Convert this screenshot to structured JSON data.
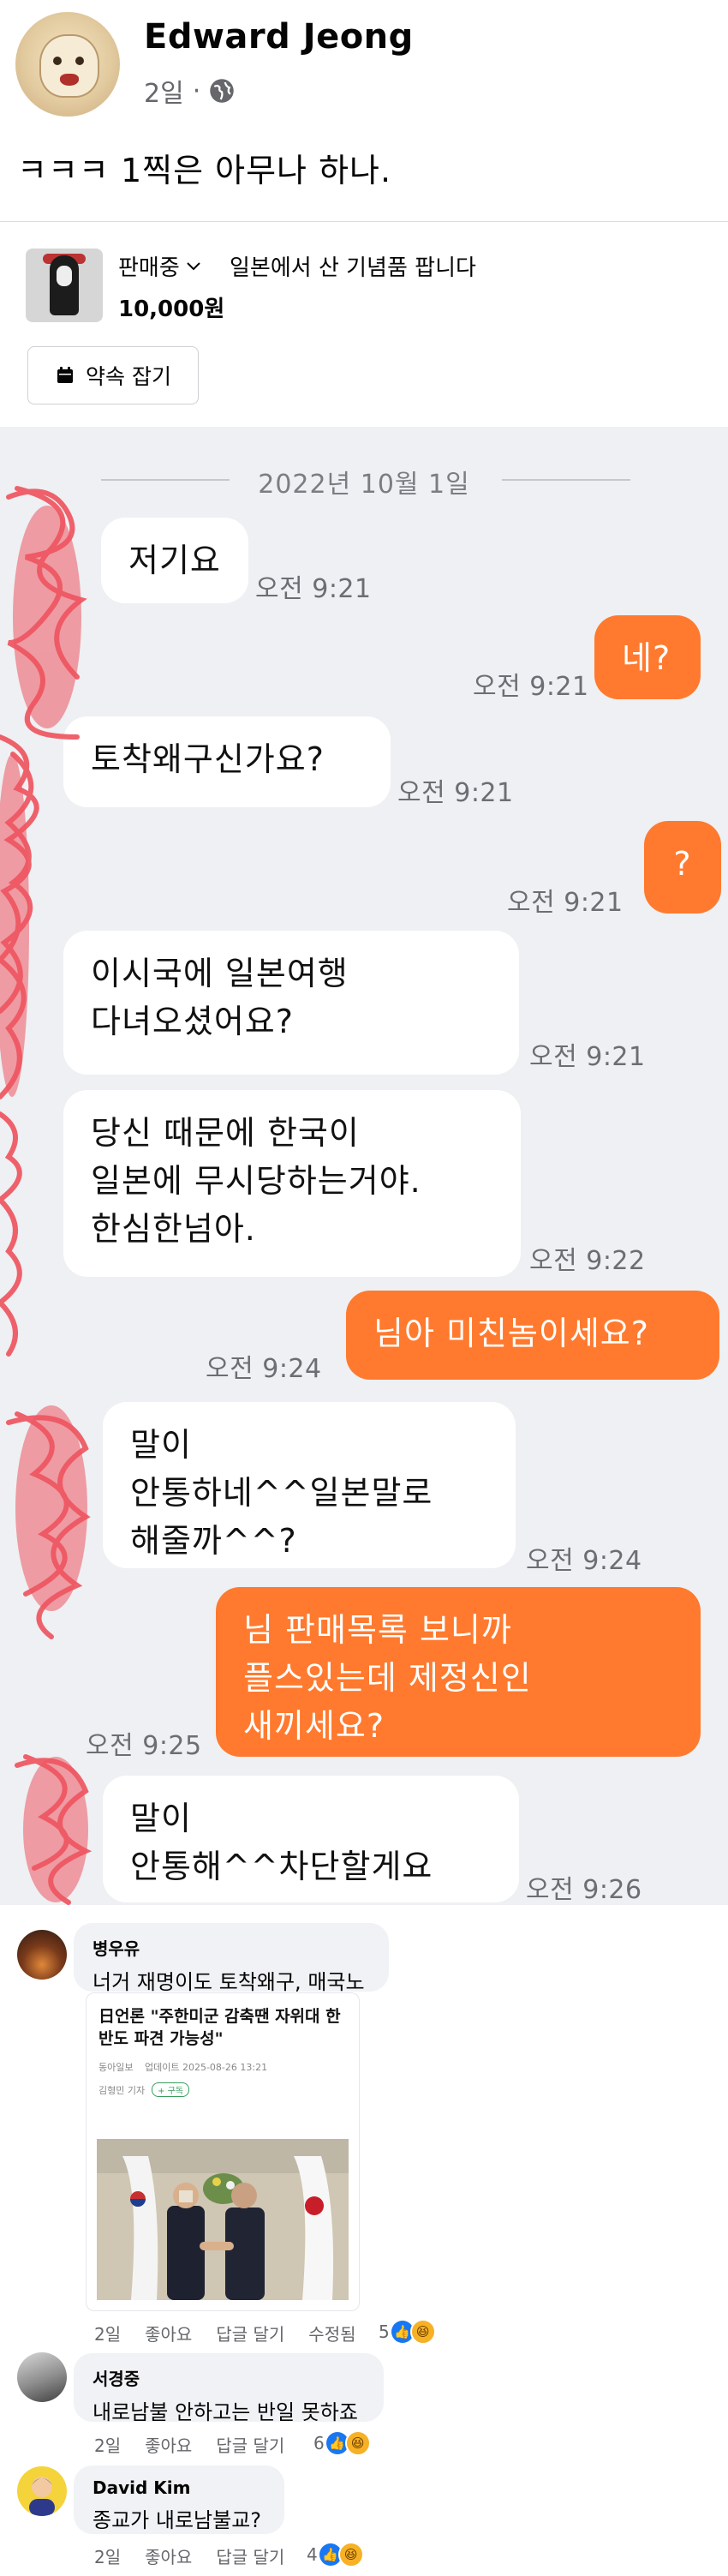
{
  "post": {
    "author": "Edward Jeong",
    "time": "2일",
    "separator": "·",
    "text": "ㅋㅋㅋ 1찍은 아무나 하나."
  },
  "listing": {
    "status": "판매중",
    "title": "일본에서 산 기념품 팝니다",
    "price": "10,000원",
    "appointment_label": "약속 잡기"
  },
  "chat": {
    "date": "2022년 10월 1일",
    "messages": [
      {
        "dir": "in",
        "text": "저기요",
        "time": "오전 9:21"
      },
      {
        "dir": "out",
        "text": "네?",
        "time": "오전 9:21"
      },
      {
        "dir": "in",
        "text": "토착왜구신가요?",
        "time": "오전 9:21"
      },
      {
        "dir": "out",
        "text": "?",
        "time": "오전 9:21"
      },
      {
        "dir": "in",
        "text": "이시국에 일본여행\n다녀오셨어요?",
        "time": "오전 9:21"
      },
      {
        "dir": "in",
        "text": "당신 때문에 한국이\n일본에 무시당하는거야.\n한심한넘아.",
        "time": "오전 9:22"
      },
      {
        "dir": "out",
        "text": "님아 미친놈이세요?",
        "time": "오전 9:24"
      },
      {
        "dir": "in",
        "text": "말이\n안통하네^^일본말로\n해줄까^^?",
        "time": "오전 9:24"
      },
      {
        "dir": "out",
        "text": "님 판매목록 보니까\n플스있는데 제정신인\n새끼세요?",
        "time": "오전 9:25"
      },
      {
        "dir": "in",
        "text": "말이\n안통해^^차단할게요",
        "time": "오전 9:26"
      }
    ]
  },
  "comments": [
    {
      "name": "병우유",
      "text": "너거 재명이도 토착왜구, 매국노",
      "time": "2일",
      "like": "좋아요",
      "reply": "답글 달기",
      "edited": "수정됨",
      "reactions": "5",
      "attachment": {
        "headline": "日언론 \"주한미군 감축땐 자위대 한반도 파견 가능성\"",
        "source": "동아일보",
        "updated": "업데이트 2025-08-26 13:21",
        "reporter": "김형민 기자",
        "subscribe": "+ 구독"
      }
    },
    {
      "name": "서경중",
      "text": "내로남불 안하고는 반일 못하죠",
      "time": "2일",
      "like": "좋아요",
      "reply": "답글 달기",
      "reactions": "6"
    },
    {
      "name": "David Kim",
      "text": "종교가 내로남불교?",
      "time": "2일",
      "like": "좋아요",
      "reply": "답글 달기",
      "reactions": "4"
    }
  ],
  "icons": {
    "audience": "globe-icon",
    "status_dropdown": "chevron-down-icon",
    "appointment": "calendar-icon",
    "like": "like-icon",
    "haha": "haha-icon"
  },
  "colors": {
    "outgoing_bubble": "#ff7a2e",
    "incoming_bubble": "#ffffff",
    "chat_background": "#eef0f3",
    "like_blue": "#1877f2",
    "haha_yellow": "#f7b125"
  }
}
